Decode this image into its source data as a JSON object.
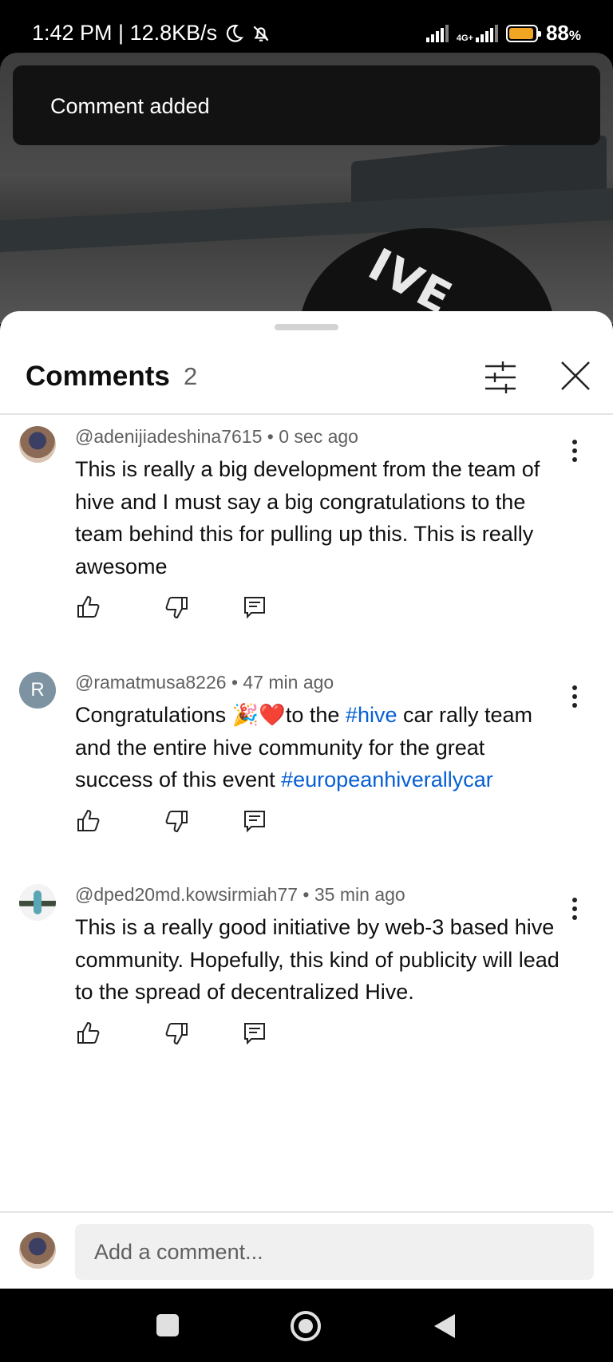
{
  "status_bar": {
    "time_speed": "1:42 PM | 12.8KB/s",
    "network": "4G+",
    "battery": "88",
    "battery_unit": "%"
  },
  "video": {
    "cap_text": "IVE"
  },
  "toast": {
    "message": "Comment added"
  },
  "sheet": {
    "title": "Comments",
    "count": "2"
  },
  "comments": [
    {
      "author": "@adenijiadeshina7615",
      "time": "0 sec ago",
      "text": "This is really a big development from the team of hive and I must say a big congratulations to the team behind this for pulling up this. This is really awesome"
    },
    {
      "author": "@ramatmusa8226",
      "time": "47 min ago",
      "avatar_letter": "R",
      "text_part1": "Congratulations 🎉❤️to the ",
      "hashtag1": "#hive",
      "text_part2": " car rally  team and the entire hive community for the great success of this event ",
      "hashtag2": "#europeanhiverallycar"
    },
    {
      "author": "@dped20md.kowsirmiah77",
      "time": "35 min ago",
      "text": "This is a really good initiative by web-3 based hive community.  Hopefully, this kind of publicity will lead to the spread of decentralized Hive."
    }
  ],
  "composer": {
    "placeholder": "Add a comment..."
  },
  "colors": {
    "link": "#065fd4",
    "text": "#0f0f0f",
    "secondary": "#606060",
    "battery": "#f0a623"
  },
  "icons": [
    "moon-icon",
    "bell-off-icon",
    "signal-icon",
    "battery-icon",
    "filter-icon",
    "close-icon",
    "more-vertical-icon",
    "thumbs-up-icon",
    "thumbs-down-icon",
    "reply-icon",
    "nav-square-icon",
    "nav-home-icon",
    "nav-back-icon"
  ]
}
